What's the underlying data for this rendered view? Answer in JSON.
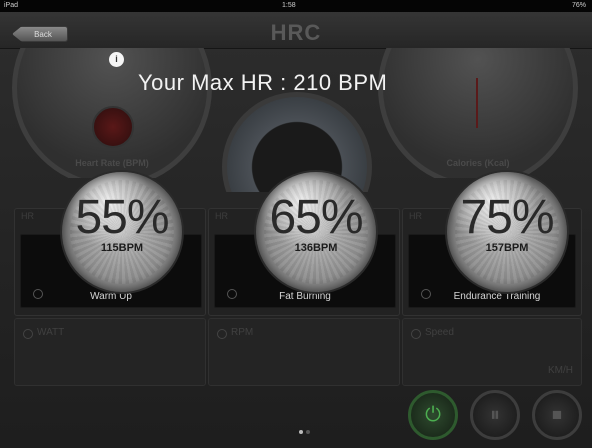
{
  "statusbar": {
    "left": "iPad",
    "center": "1:58",
    "right": "76%"
  },
  "navbar": {
    "title": "HRC",
    "back_label": "Back"
  },
  "gauges": {
    "left_label": "Heart Rate (BPM)",
    "right_label": "Calories (Kcal)"
  },
  "overlay": {
    "max_hr_text": "Your Max HR : 210 BPM",
    "info_icon": "info-icon"
  },
  "zones": [
    {
      "percent": "55%",
      "bpm": "115BPM",
      "name": "Warm Up"
    },
    {
      "percent": "65%",
      "bpm": "136BPM",
      "name": "Fat Burning"
    },
    {
      "percent": "75%",
      "bpm": "157BPM",
      "name": "Endurance Training"
    }
  ],
  "panels": {
    "heads": [
      "HR",
      "HR",
      "HR"
    ]
  },
  "stats": {
    "watt_label": "WATT",
    "rpm_label": "RPM",
    "speed_label": "Speed",
    "speed_unit": "KM/H"
  },
  "colors": {
    "background": "#000000",
    "panel": "#232323",
    "text_highlight": "#f2f2f2",
    "accent_green": "#2e7d32"
  }
}
